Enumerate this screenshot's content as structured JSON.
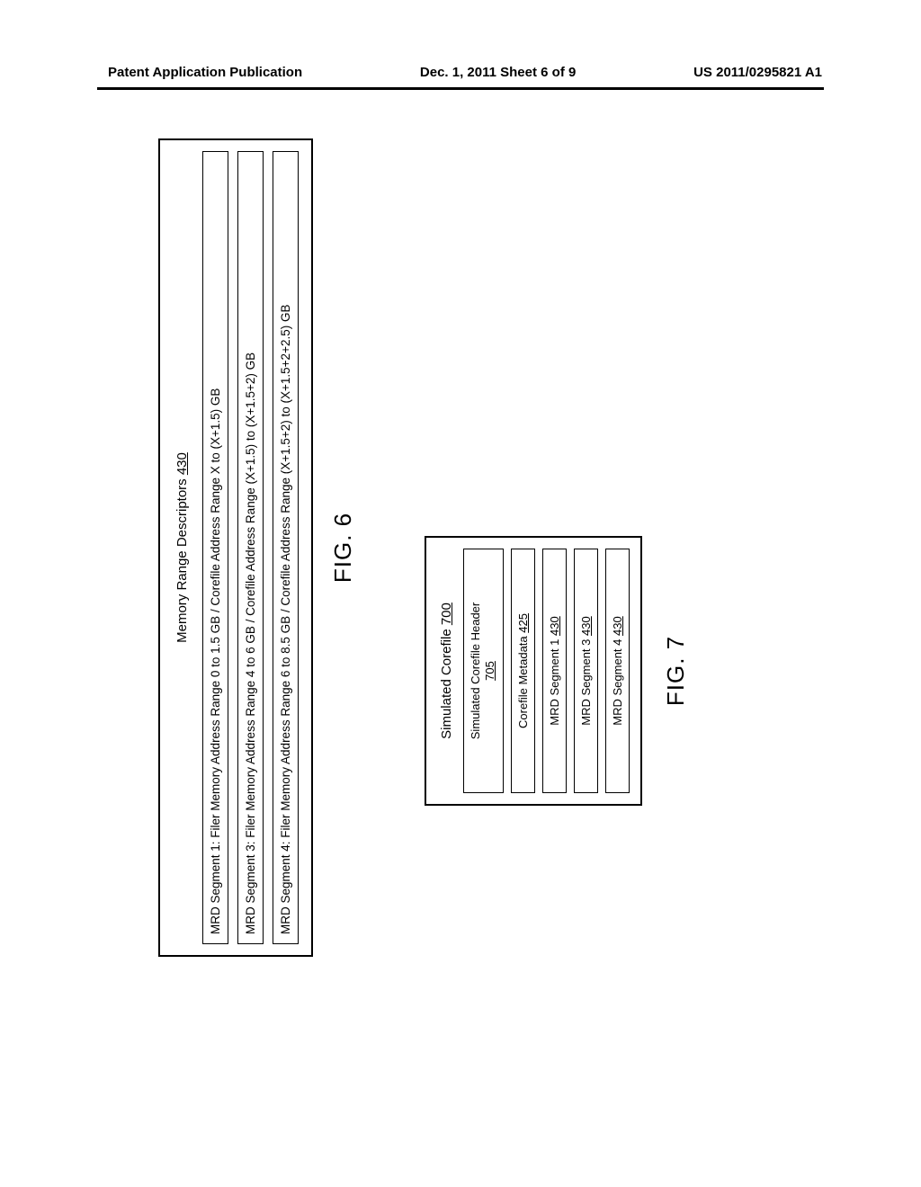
{
  "header": {
    "left": "Patent Application Publication",
    "middle": "Dec. 1, 2011  Sheet 6 of 9",
    "right": "US 2011/0295821 A1"
  },
  "fig6": {
    "title_prefix": "Memory Range Descriptors ",
    "title_ref": "430",
    "rows": [
      "MRD Segment 1: Filer Memory Address Range 0 to 1.5 GB  /  Corefile Address Range X to (X+1.5) GB",
      "MRD Segment 3: Filer Memory Address Range 4 to 6 GB  /  Corefile Address Range (X+1.5) to (X+1.5+2) GB",
      "MRD Segment 4: Filer Memory Address Range 6 to 8.5 GB  /  Corefile Address Range (X+1.5+2) to (X+1.5+2+2.5) GB"
    ],
    "label": "FIG. 6"
  },
  "fig7": {
    "title_prefix": "Simulated Corefile ",
    "title_ref": "700",
    "header_box_line1": "Simulated Corefile Header",
    "header_box_ref": "705",
    "rows": [
      {
        "text": "Corefile Metadata ",
        "ref": "425"
      },
      {
        "text": "MRD Segment 1 ",
        "ref": "430"
      },
      {
        "text": "MRD Segment 3 ",
        "ref": "430"
      },
      {
        "text": "MRD Segment 4 ",
        "ref": "430"
      }
    ],
    "label": "FIG. 7"
  }
}
